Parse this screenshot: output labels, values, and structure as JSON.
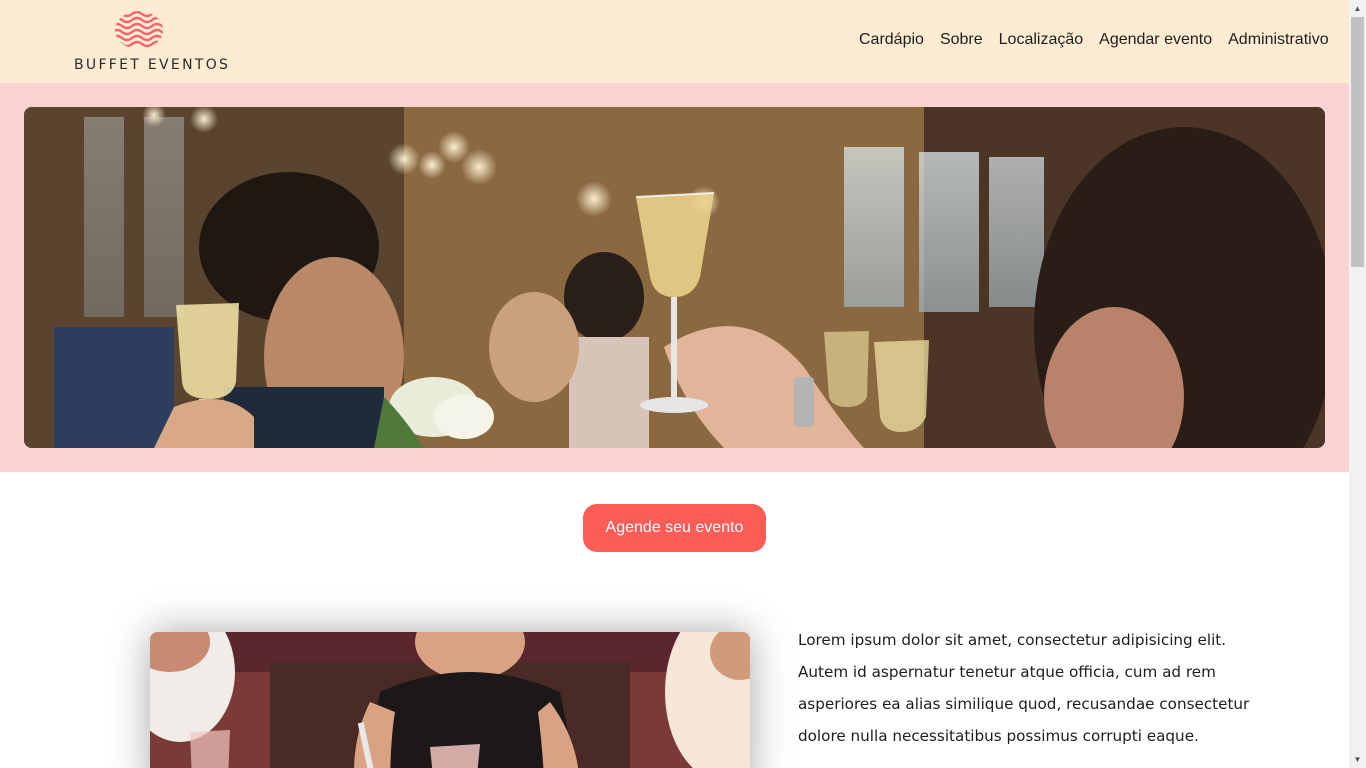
{
  "header": {
    "logo_text": "BUFFET EVENTOS",
    "logo_icon": "wave-pattern-logo-icon",
    "brand_color": "#f7616a",
    "background": "#fdecd1"
  },
  "nav": {
    "items": [
      {
        "label": "Cardápio"
      },
      {
        "label": "Sobre"
      },
      {
        "label": "Localização"
      },
      {
        "label": "Agendar evento"
      },
      {
        "label": "Administrativo"
      }
    ]
  },
  "hero": {
    "background": "#fbd3d2",
    "image": "celebration-toast-photo"
  },
  "cta": {
    "label": "Agende seu evento",
    "color": "#fd5c57"
  },
  "feature": {
    "image": "friends-toasting-photo",
    "text": "Lorem ipsum dolor sit amet, consectetur adipisicing elit. Autem id aspernatur tenetur atque officia, cum ad rem asperiores ea alias similique quod, recusandae consectetur dolore nulla necessitatibus possimus corrupti eaque."
  }
}
